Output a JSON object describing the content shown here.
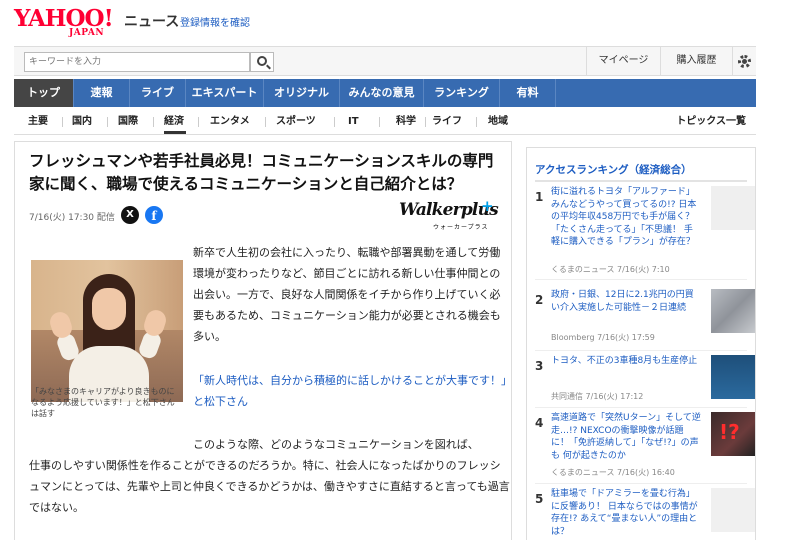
{
  "header": {
    "logo_text": "YAHOO!",
    "logo_sub": "JAPAN",
    "service_name": "ニュース",
    "register_link": "登録情報を確認",
    "search_placeholder": "キーワードを入力",
    "mypage": "マイページ",
    "history": "購入履歴",
    "settings_icon": "gear-icon"
  },
  "main_nav": [
    {
      "label": "トップ",
      "active": true,
      "width": 60
    },
    {
      "label": "速報",
      "width": 56
    },
    {
      "label": "ライブ",
      "width": 56
    },
    {
      "label": "エキスパート",
      "width": 78
    },
    {
      "label": "オリジナル",
      "width": 76
    },
    {
      "label": "みんなの意見",
      "width": 84
    },
    {
      "label": "ランキング",
      "width": 76
    },
    {
      "label": "有料",
      "width": 56
    }
  ],
  "sub_nav": {
    "items": [
      "主要",
      "国内",
      "国際",
      "経済",
      "エンタメ",
      "スポーツ",
      "IT",
      "科学",
      "ライフ",
      "地域"
    ],
    "active": "経済",
    "topics": "トピックス一覧"
  },
  "article": {
    "title": "フレッシュマンや若手社員必見！コミュニケーションスキルの専門家に聞く、職場で使えるコミュニケーションと自己紹介とは？",
    "date": "7/16(火) 17:30 配信",
    "share_x": "X",
    "share_fb": "f",
    "media": {
      "name": "Walkerplus",
      "plus": "+",
      "kana": "ウォーカープラス"
    },
    "photo_caption": "「みなさまのキャリアがより良きものになるよう応援しています！」と松下さんは話す",
    "paragraph1": "新卒で人生初の会社に入ったり、転職や部署異動を通して労働環境が変わったりなど、節目ごとに訪れる新しい仕事仲間との出会い。一方で、良好な人間関係をイチから作り上げていく必要もあるため、コミュニケーション能力が必要とされる機会も多い。",
    "quote": "「新人時代は、自分から積極的に話しかけることが大事です！」と松下さん",
    "paragraph2_first": "このような際、どのようなコミュニケーションを図れば、",
    "paragraph2_rest": "仕事のしやすい関係性を作ることができるのだろうか。特に、社会人になったばかりのフレッシュマンにとっては、先輩や上司と仲良くできるかどうかは、働きやすさに直結すると言っても過言ではない。"
  },
  "ranking": {
    "title": "アクセスランキング（経済総合）",
    "items": [
      {
        "rank": "1",
        "headline": "街に溢れるトヨタ「アルファード」みんなどうやって買ってるの!? 日本の平均年収458万円でも手が届く？「たくさん走ってる」「不思議！ 手軽に購入できる「プラン」が存在？",
        "source": "くるまのニュース 7/16(火) 7:10"
      },
      {
        "rank": "2",
        "headline": "政府・日銀、12日に2.1兆円の円買い介入実施した可能性－２日連続",
        "source": "Bloomberg 7/16(火) 17:59"
      },
      {
        "rank": "3",
        "headline": "トヨタ、不正の3車種8月も生産停止",
        "source": "共同通信 7/16(火) 17:12"
      },
      {
        "rank": "4",
        "headline": "高速道路で「突然Uターン」そして逆走…!? NEXCOの衝撃映像が話題に！「免許返納して」「なぜ!?」の声も 何が起きたのか",
        "source": "くるまのニュース 7/16(火) 16:40"
      },
      {
        "rank": "5",
        "headline": "駐車場で「ドアミラーを畳む行為」に反響あり！ 日本ならではの事情が存在!? あえて“畳まない人”の理由とは？",
        "source": ""
      }
    ]
  }
}
